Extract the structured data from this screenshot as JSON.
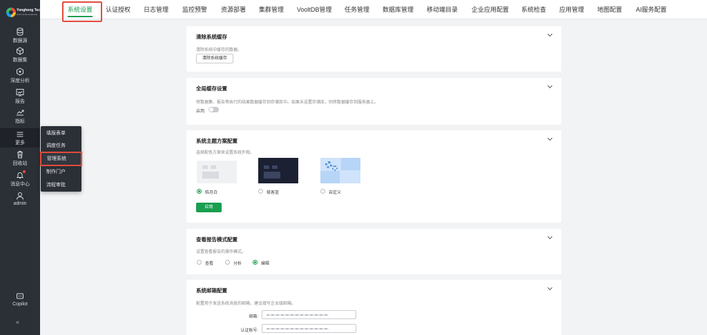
{
  "sidebar": {
    "logo": {
      "brand": "Yonghong Tech",
      "sub": "DATA INTELLIGENCE"
    },
    "items": [
      {
        "label": "数据源",
        "icon": "database-icon"
      },
      {
        "label": "数据集",
        "icon": "dataset-cube-icon"
      },
      {
        "label": "深度分析",
        "icon": "deep-analysis-icon"
      },
      {
        "label": "报告",
        "icon": "report-chart-icon"
      },
      {
        "label": "指标",
        "icon": "metric-trend-icon"
      },
      {
        "label": "更多",
        "icon": "menu-icon"
      },
      {
        "label": "回收站",
        "icon": "trash-icon"
      },
      {
        "label": "消息中心",
        "icon": "bell-icon"
      },
      {
        "label": "admin",
        "icon": "user-icon"
      },
      {
        "label": "Copilot",
        "icon": "copilot-icon"
      }
    ],
    "collapse_glyph": "«"
  },
  "more_menu": {
    "items": [
      "填报表单",
      "调度任务",
      "管理系统",
      "制作门户",
      "流程审批"
    ]
  },
  "tabs": [
    "系统设置",
    "认证授权",
    "日志管理",
    "监控预警",
    "资源部署",
    "集群管理",
    "VooltDB管理",
    "任务管理",
    "数据库管理",
    "移动端目录",
    "企业应用配置",
    "系统检查",
    "应用管理",
    "地图配置",
    "AI服务配置"
  ],
  "active_tab": "系统设置",
  "colors": {
    "accent": "#1a9e4f",
    "highlight_border": "#e34b3b",
    "sidebar_bg": "#2b2f36"
  },
  "cards": {
    "clear_cache": {
      "title": "清除系统缓存",
      "desc": "清除系统中缓存的数据。",
      "button": "清除系统缓存"
    },
    "global_cache": {
      "title": "全局缓存设置",
      "desc": "将数据集、报告等执行的结果数据缓存到存储库中。如果未设置存储库，则将数据缓存到服务器上。",
      "switch_label": "启用:",
      "enabled": false
    },
    "theme": {
      "title": "系统主题方案配置",
      "desc": "选择配色方案来设置系统外观。",
      "options": [
        "皓月白",
        "极客蓝",
        "自定义"
      ],
      "selected": "皓月白",
      "apply_button": "应用"
    },
    "report_mode": {
      "title": "查看报告模式配置",
      "desc": "设置查看报告的操作模式。",
      "options": [
        "查看",
        "分析",
        "编辑"
      ],
      "selected": "编辑"
    },
    "mail": {
      "title": "系统邮箱配置",
      "desc": "配置用于发送系统消息的邮箱，建议填写企业级邮箱。",
      "email_label": "邮箱:",
      "account_label": "认证账号:"
    }
  }
}
